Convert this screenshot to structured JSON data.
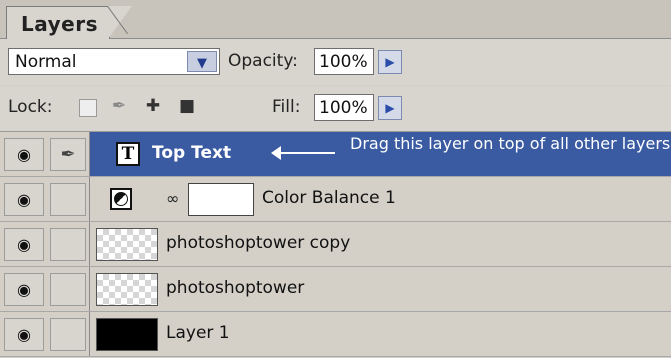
{
  "panel": {
    "tab_label": "Layers"
  },
  "blend": {
    "mode": "Normal",
    "opacity_label": "Opacity:",
    "opacity_value": "100%"
  },
  "lock": {
    "label": "Lock:",
    "fill_label": "Fill:",
    "fill_value": "100%"
  },
  "layers": [
    {
      "name": "Top Text",
      "type": "text",
      "selected": true
    },
    {
      "name": "Color Balance 1",
      "type": "adjustment"
    },
    {
      "name": "photoshoptower copy",
      "type": "pixel"
    },
    {
      "name": "photoshoptower",
      "type": "pixel"
    },
    {
      "name": "Layer 1",
      "type": "pixel"
    }
  ],
  "annotation": {
    "text": "Drag this layer on top of all other layers"
  },
  "colors": {
    "selected_row": "#3a5ba2",
    "panel_bg": "#d4d0c8"
  }
}
